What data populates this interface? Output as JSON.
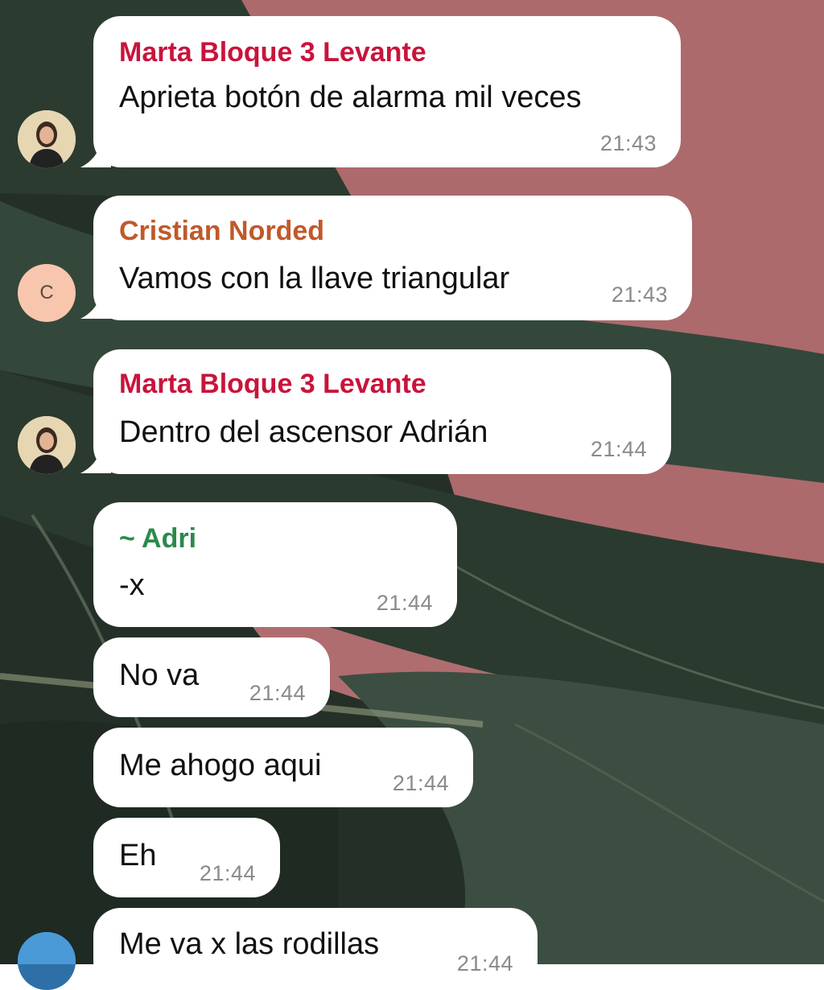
{
  "theme": {
    "name_color_marta": "#c8143c",
    "name_color_cristian": "#c0592a",
    "name_color_adri": "#2a8a4a",
    "bubble_bg": "#ffffff",
    "timestamp_color": "#8a8a8a"
  },
  "messages": [
    {
      "sender": "Marta Bloque 3 Levante",
      "text": "Aprieta botón de alarma mil veces",
      "time": "21:43",
      "avatar": "photo"
    },
    {
      "sender": "Cristian Norded",
      "text": "Vamos con la llave triangular",
      "time": "21:43",
      "avatar": "letter",
      "avatar_letter": "C"
    },
    {
      "sender": "Marta Bloque 3 Levante",
      "text": "Dentro del ascensor Adrián",
      "time": "21:44",
      "avatar": "photo"
    },
    {
      "sender": "~ Adri",
      "text": "-x",
      "time": "21:44"
    },
    {
      "text": "No va",
      "time": "21:44"
    },
    {
      "text": "Me ahogo aqui",
      "time": "21:44"
    },
    {
      "text": "Eh",
      "time": "21:44"
    },
    {
      "text": "Me va x las rodillas",
      "time": "21:44",
      "avatar": "photo-blue"
    }
  ]
}
